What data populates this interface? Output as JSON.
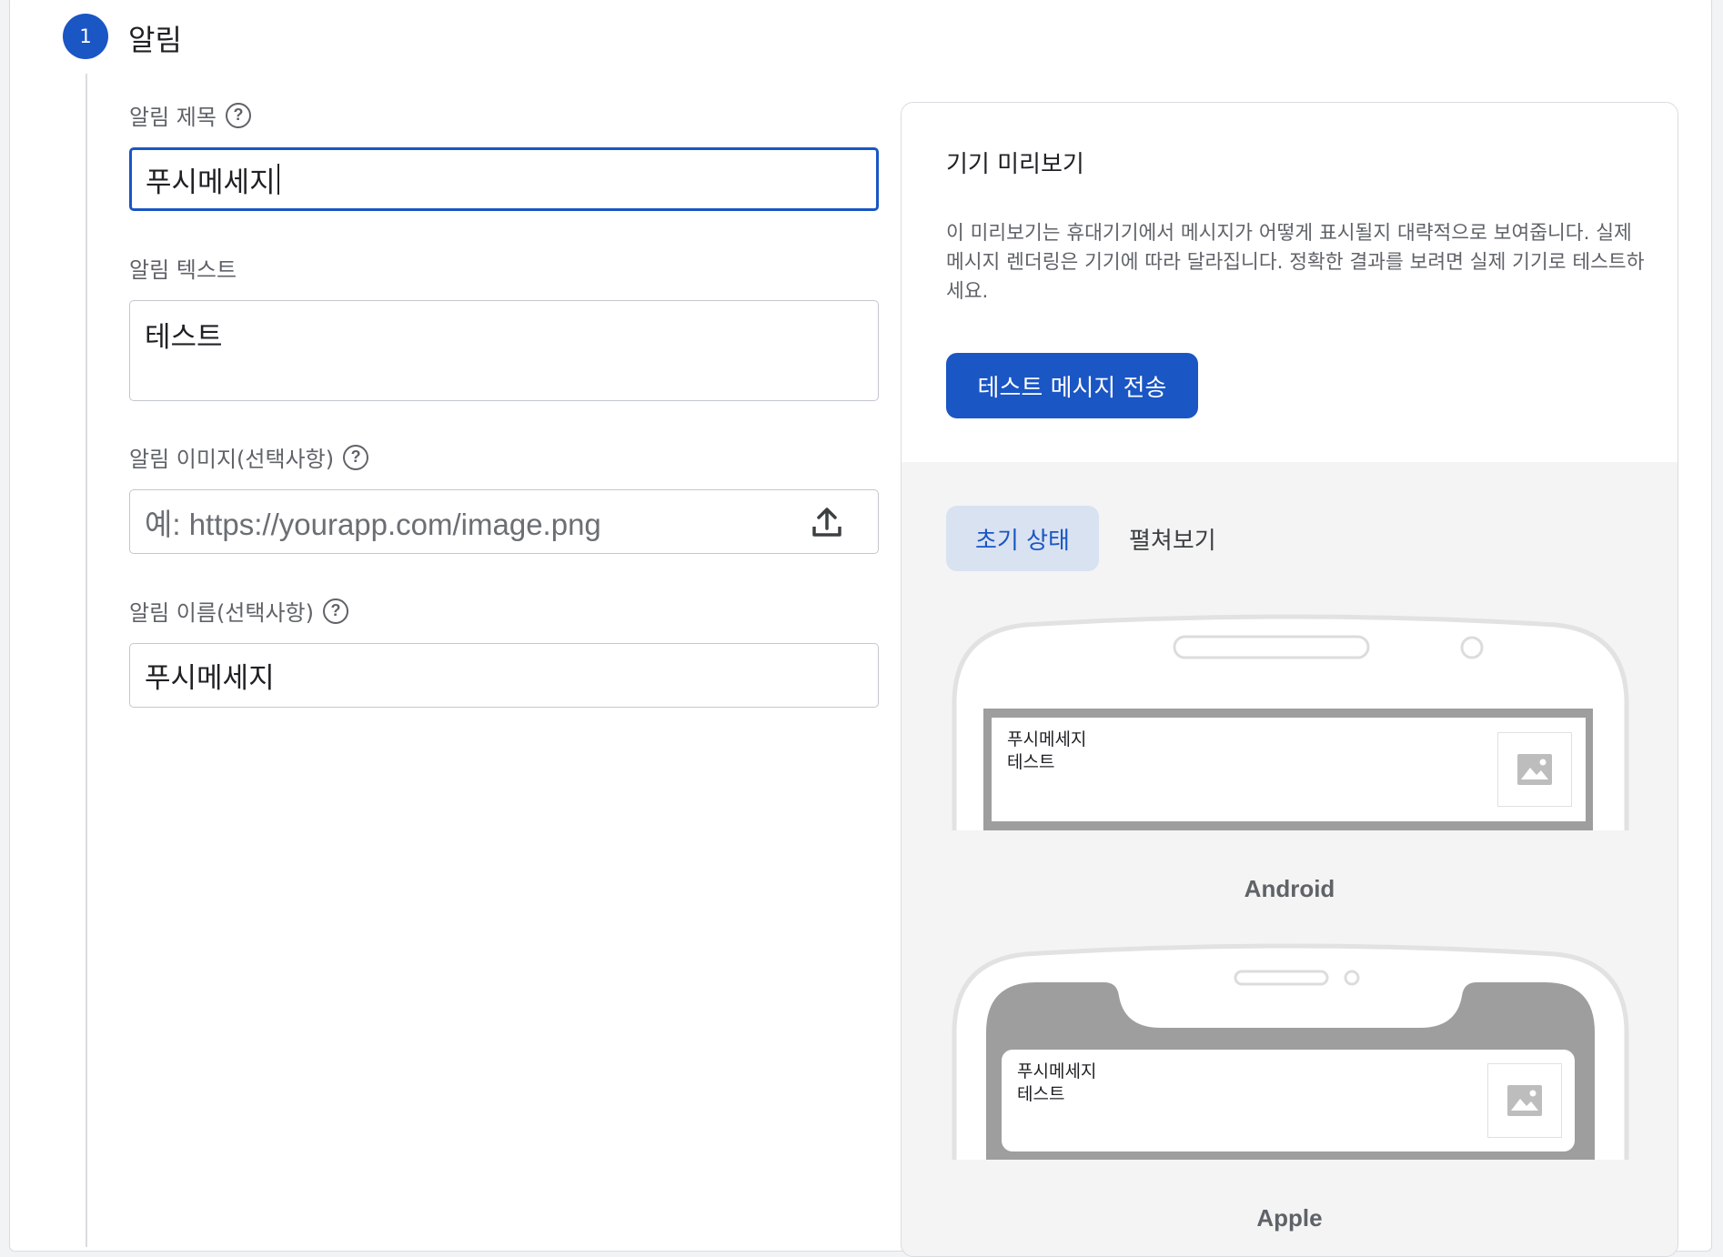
{
  "step": {
    "number": "1",
    "title": "알림"
  },
  "form": {
    "title_label": "알림 제목",
    "title_value": "푸시메세지",
    "text_label": "알림 텍스트",
    "text_value": "테스트",
    "image_label": "알림 이미지(선택사항)",
    "image_placeholder": "예: https://yourapp.com/image.png",
    "name_label": "알림 이름(선택사항)",
    "name_value": "푸시메세지"
  },
  "preview": {
    "title": "기기 미리보기",
    "description": "이 미리보기는 휴대기기에서 메시지가 어떻게 표시될지 대략적으로 보여줍니다. 실제 메시지 렌더링은 기기에 따라 달라집니다. 정확한 결과를 보려면 실제 기기로 테스트하세요.",
    "send_button": "테스트 메시지 전송",
    "tabs": [
      {
        "label": "초기 상태",
        "active": true
      },
      {
        "label": "펼쳐보기",
        "active": false
      }
    ],
    "devices": [
      {
        "label": "Android",
        "notif_title": "푸시메세지",
        "notif_text": "테스트"
      },
      {
        "label": "Apple",
        "notif_title": "푸시메세지",
        "notif_text": "테스트"
      }
    ]
  },
  "icons": {
    "help": "help-circle-icon",
    "upload": "upload-icon",
    "image_placeholder": "image-icon"
  },
  "colors": {
    "accent": "#1a56c4",
    "tab_active_bg": "#d9e2f1"
  }
}
